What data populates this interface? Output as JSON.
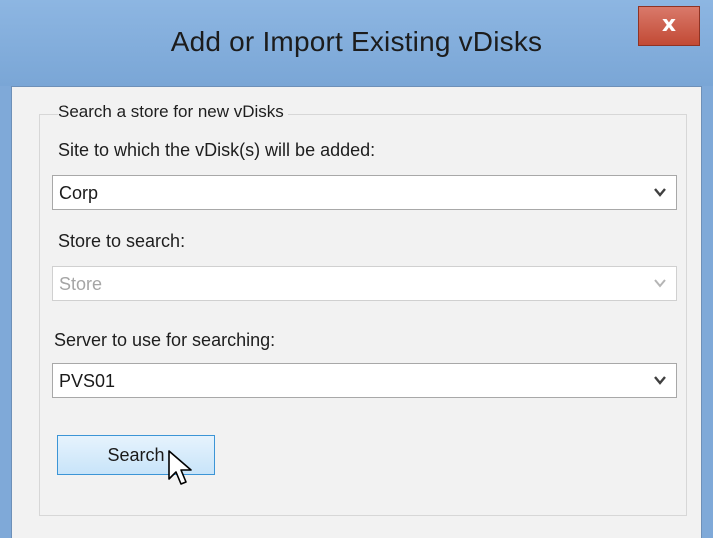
{
  "window": {
    "title": "Add or Import Existing vDisks",
    "close_label": "x"
  },
  "group": {
    "legend": "Search a store for new vDisks"
  },
  "site": {
    "label": "Site to which the vDisk(s) will be added:",
    "value": "Corp"
  },
  "store": {
    "label": "Store to search:",
    "value": "Store",
    "enabled": false
  },
  "server": {
    "label": "Server to use for searching:",
    "value": "PVS01"
  },
  "search_button": {
    "label": "Search"
  },
  "icons": {
    "close": "close-icon",
    "dropdown": "chevron-down-icon",
    "cursor": "mouse-pointer-icon"
  },
  "colors": {
    "titlebar": "#7fa9d8",
    "close_button": "#c94b38",
    "button_border": "#3c95d6",
    "client_bg": "#f2f2f2"
  }
}
